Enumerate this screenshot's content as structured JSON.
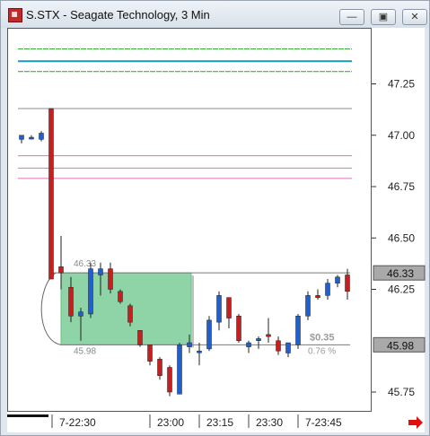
{
  "window": {
    "title": "S.STX - Seagate Technology, 3 Min",
    "buttons": {
      "minimize": "—",
      "maximize": "▣",
      "close": "✕"
    }
  },
  "price_axis": {
    "ticks": [
      "47.25",
      "47.00",
      "46.75",
      "46.50",
      "46.25",
      "45.75"
    ],
    "tags": [
      "46.33",
      "45.98"
    ]
  },
  "time_axis": {
    "ticks": [
      "7-22:30",
      "23:00",
      "23:15",
      "23:30",
      "7-23:45"
    ]
  },
  "measure": {
    "high_label": "46.33",
    "low_label": "45.98",
    "change": "$0.35",
    "percent": "0.76 %"
  },
  "colors": {
    "up": "#1f5fcf",
    "down": "#c81e1e",
    "measure_box": "#8fd4a6",
    "level_green": "#2aa02a",
    "level_teal": "#1899b8",
    "level_pink": "#e36fc0",
    "nav_arrow": "#e01010"
  },
  "chart_data": {
    "type": "candlestick",
    "title": "S.STX - Seagate Technology, 3 Min",
    "ylim": [
      45.67,
      47.52
    ],
    "yticks": [
      45.75,
      46.25,
      46.5,
      46.75,
      47.0,
      47.25
    ],
    "xticks": [
      "7-22:30",
      "23:00",
      "23:15",
      "23:30",
      "7-23:45"
    ],
    "candles": [
      {
        "o": 46.98,
        "h": 47.0,
        "l": 46.96,
        "c": 47.0
      },
      {
        "o": 46.99,
        "h": 47.0,
        "l": 46.98,
        "c": 46.99
      },
      {
        "o": 46.98,
        "h": 47.02,
        "l": 46.97,
        "c": 47.01
      },
      {
        "o": 47.13,
        "h": 47.13,
        "l": 46.3,
        "c": 46.3
      },
      {
        "o": 46.36,
        "h": 46.51,
        "l": 46.25,
        "c": 46.33
      },
      {
        "o": 46.26,
        "h": 46.31,
        "l": 46.09,
        "c": 46.12
      },
      {
        "o": 46.12,
        "h": 46.16,
        "l": 46.0,
        "c": 46.14
      },
      {
        "o": 46.13,
        "h": 46.38,
        "l": 46.11,
        "c": 46.35
      },
      {
        "o": 46.32,
        "h": 46.38,
        "l": 46.22,
        "c": 46.35
      },
      {
        "o": 46.35,
        "h": 46.38,
        "l": 46.23,
        "c": 46.25
      },
      {
        "o": 46.24,
        "h": 46.25,
        "l": 46.18,
        "c": 46.19
      },
      {
        "o": 46.17,
        "h": 46.18,
        "l": 46.07,
        "c": 46.09
      },
      {
        "o": 46.05,
        "h": 46.05,
        "l": 45.97,
        "c": 45.98
      },
      {
        "o": 45.98,
        "h": 45.98,
        "l": 45.88,
        "c": 45.9
      },
      {
        "o": 45.91,
        "h": 45.92,
        "l": 45.81,
        "c": 45.83
      },
      {
        "o": 45.87,
        "h": 45.88,
        "l": 45.73,
        "c": 45.75
      },
      {
        "o": 45.74,
        "h": 45.99,
        "l": 45.74,
        "c": 45.98
      },
      {
        "o": 45.97,
        "h": 46.03,
        "l": 45.94,
        "c": 45.99
      },
      {
        "o": 45.95,
        "h": 45.99,
        "l": 45.88,
        "c": 45.95
      },
      {
        "o": 45.96,
        "h": 46.12,
        "l": 45.95,
        "c": 46.1
      },
      {
        "o": 46.09,
        "h": 46.24,
        "l": 46.05,
        "c": 46.22
      },
      {
        "o": 46.21,
        "h": 46.21,
        "l": 46.06,
        "c": 46.11
      },
      {
        "o": 46.12,
        "h": 46.13,
        "l": 45.99,
        "c": 46.0
      },
      {
        "o": 45.97,
        "h": 46.0,
        "l": 45.94,
        "c": 45.99
      },
      {
        "o": 46.0,
        "h": 46.02,
        "l": 45.96,
        "c": 46.01
      },
      {
        "o": 46.03,
        "h": 46.11,
        "l": 45.99,
        "c": 46.02
      },
      {
        "o": 46.0,
        "h": 46.02,
        "l": 45.93,
        "c": 45.95
      },
      {
        "o": 45.94,
        "h": 45.99,
        "l": 45.92,
        "c": 45.99
      },
      {
        "o": 45.98,
        "h": 46.13,
        "l": 45.96,
        "c": 46.12
      },
      {
        "o": 46.12,
        "h": 46.24,
        "l": 46.1,
        "c": 46.22
      },
      {
        "o": 46.22,
        "h": 46.25,
        "l": 46.2,
        "c": 46.21
      },
      {
        "o": 46.22,
        "h": 46.3,
        "l": 46.2,
        "c": 46.28
      },
      {
        "o": 46.28,
        "h": 46.32,
        "l": 46.26,
        "c": 46.31
      },
      {
        "o": 46.32,
        "h": 46.35,
        "l": 46.2,
        "c": 46.24
      }
    ],
    "levels": [
      {
        "value": 47.42,
        "color": "green",
        "style": "dashed"
      },
      {
        "value": 47.36,
        "color": "teal",
        "style": "solid"
      },
      {
        "value": 47.31,
        "color": "green",
        "style": "dashed"
      },
      {
        "value": 47.13,
        "color": "gray",
        "style": "solid"
      },
      {
        "value": 46.9,
        "color": "pink",
        "style": "solid"
      },
      {
        "value": 46.84,
        "color": "pink",
        "style": "solid"
      },
      {
        "value": 46.79,
        "color": "pink",
        "style": "solid"
      }
    ],
    "measure": {
      "high": 46.33,
      "low": 45.98,
      "change": 0.35,
      "percent": 0.76
    }
  }
}
